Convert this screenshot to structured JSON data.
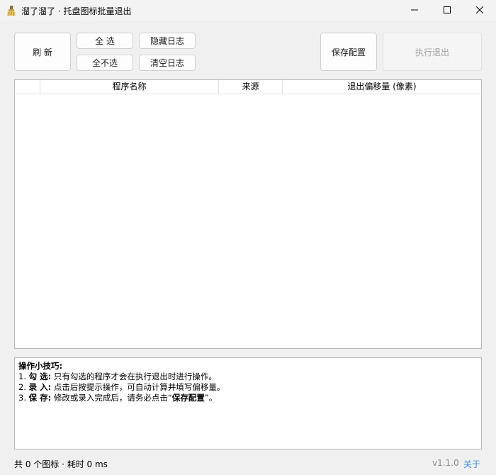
{
  "window": {
    "title": "溜了溜了 · 托盘图标批量退出"
  },
  "toolbar": {
    "refresh_label": "刷 新",
    "select_all_label": "全 选",
    "select_none_label": "全不选",
    "hide_log_label": "隐藏日志",
    "clear_log_label": "清空日志",
    "save_config_label": "保存配置",
    "execute_exit_label": "执行退出"
  },
  "table": {
    "columns": [
      "",
      "程序名称",
      "来源",
      "退出偏移量 (像素)"
    ],
    "rows": []
  },
  "tips": {
    "title": "操作小技巧:",
    "items": [
      {
        "num": "1.",
        "label": "勾 选:",
        "text": "只有勾选的程序才会在执行退出时进行操作。"
      },
      {
        "num": "2.",
        "label": "录 入:",
        "text": "点击后按提示操作，可自动计算并填写偏移量。"
      },
      {
        "num": "3.",
        "label": "保 存:",
        "text": "修改或录入完成后，请务必点击“",
        "bold": "保存配置",
        "tail": "”。"
      }
    ]
  },
  "status": {
    "summary": "共 0 个图标 · 耗时 0 ms",
    "version": "v1.1.0",
    "about": "关于"
  },
  "icons": {
    "app": "broom-icon",
    "minimize": "minimize-icon",
    "maximize": "maximize-icon",
    "close": "close-icon"
  }
}
